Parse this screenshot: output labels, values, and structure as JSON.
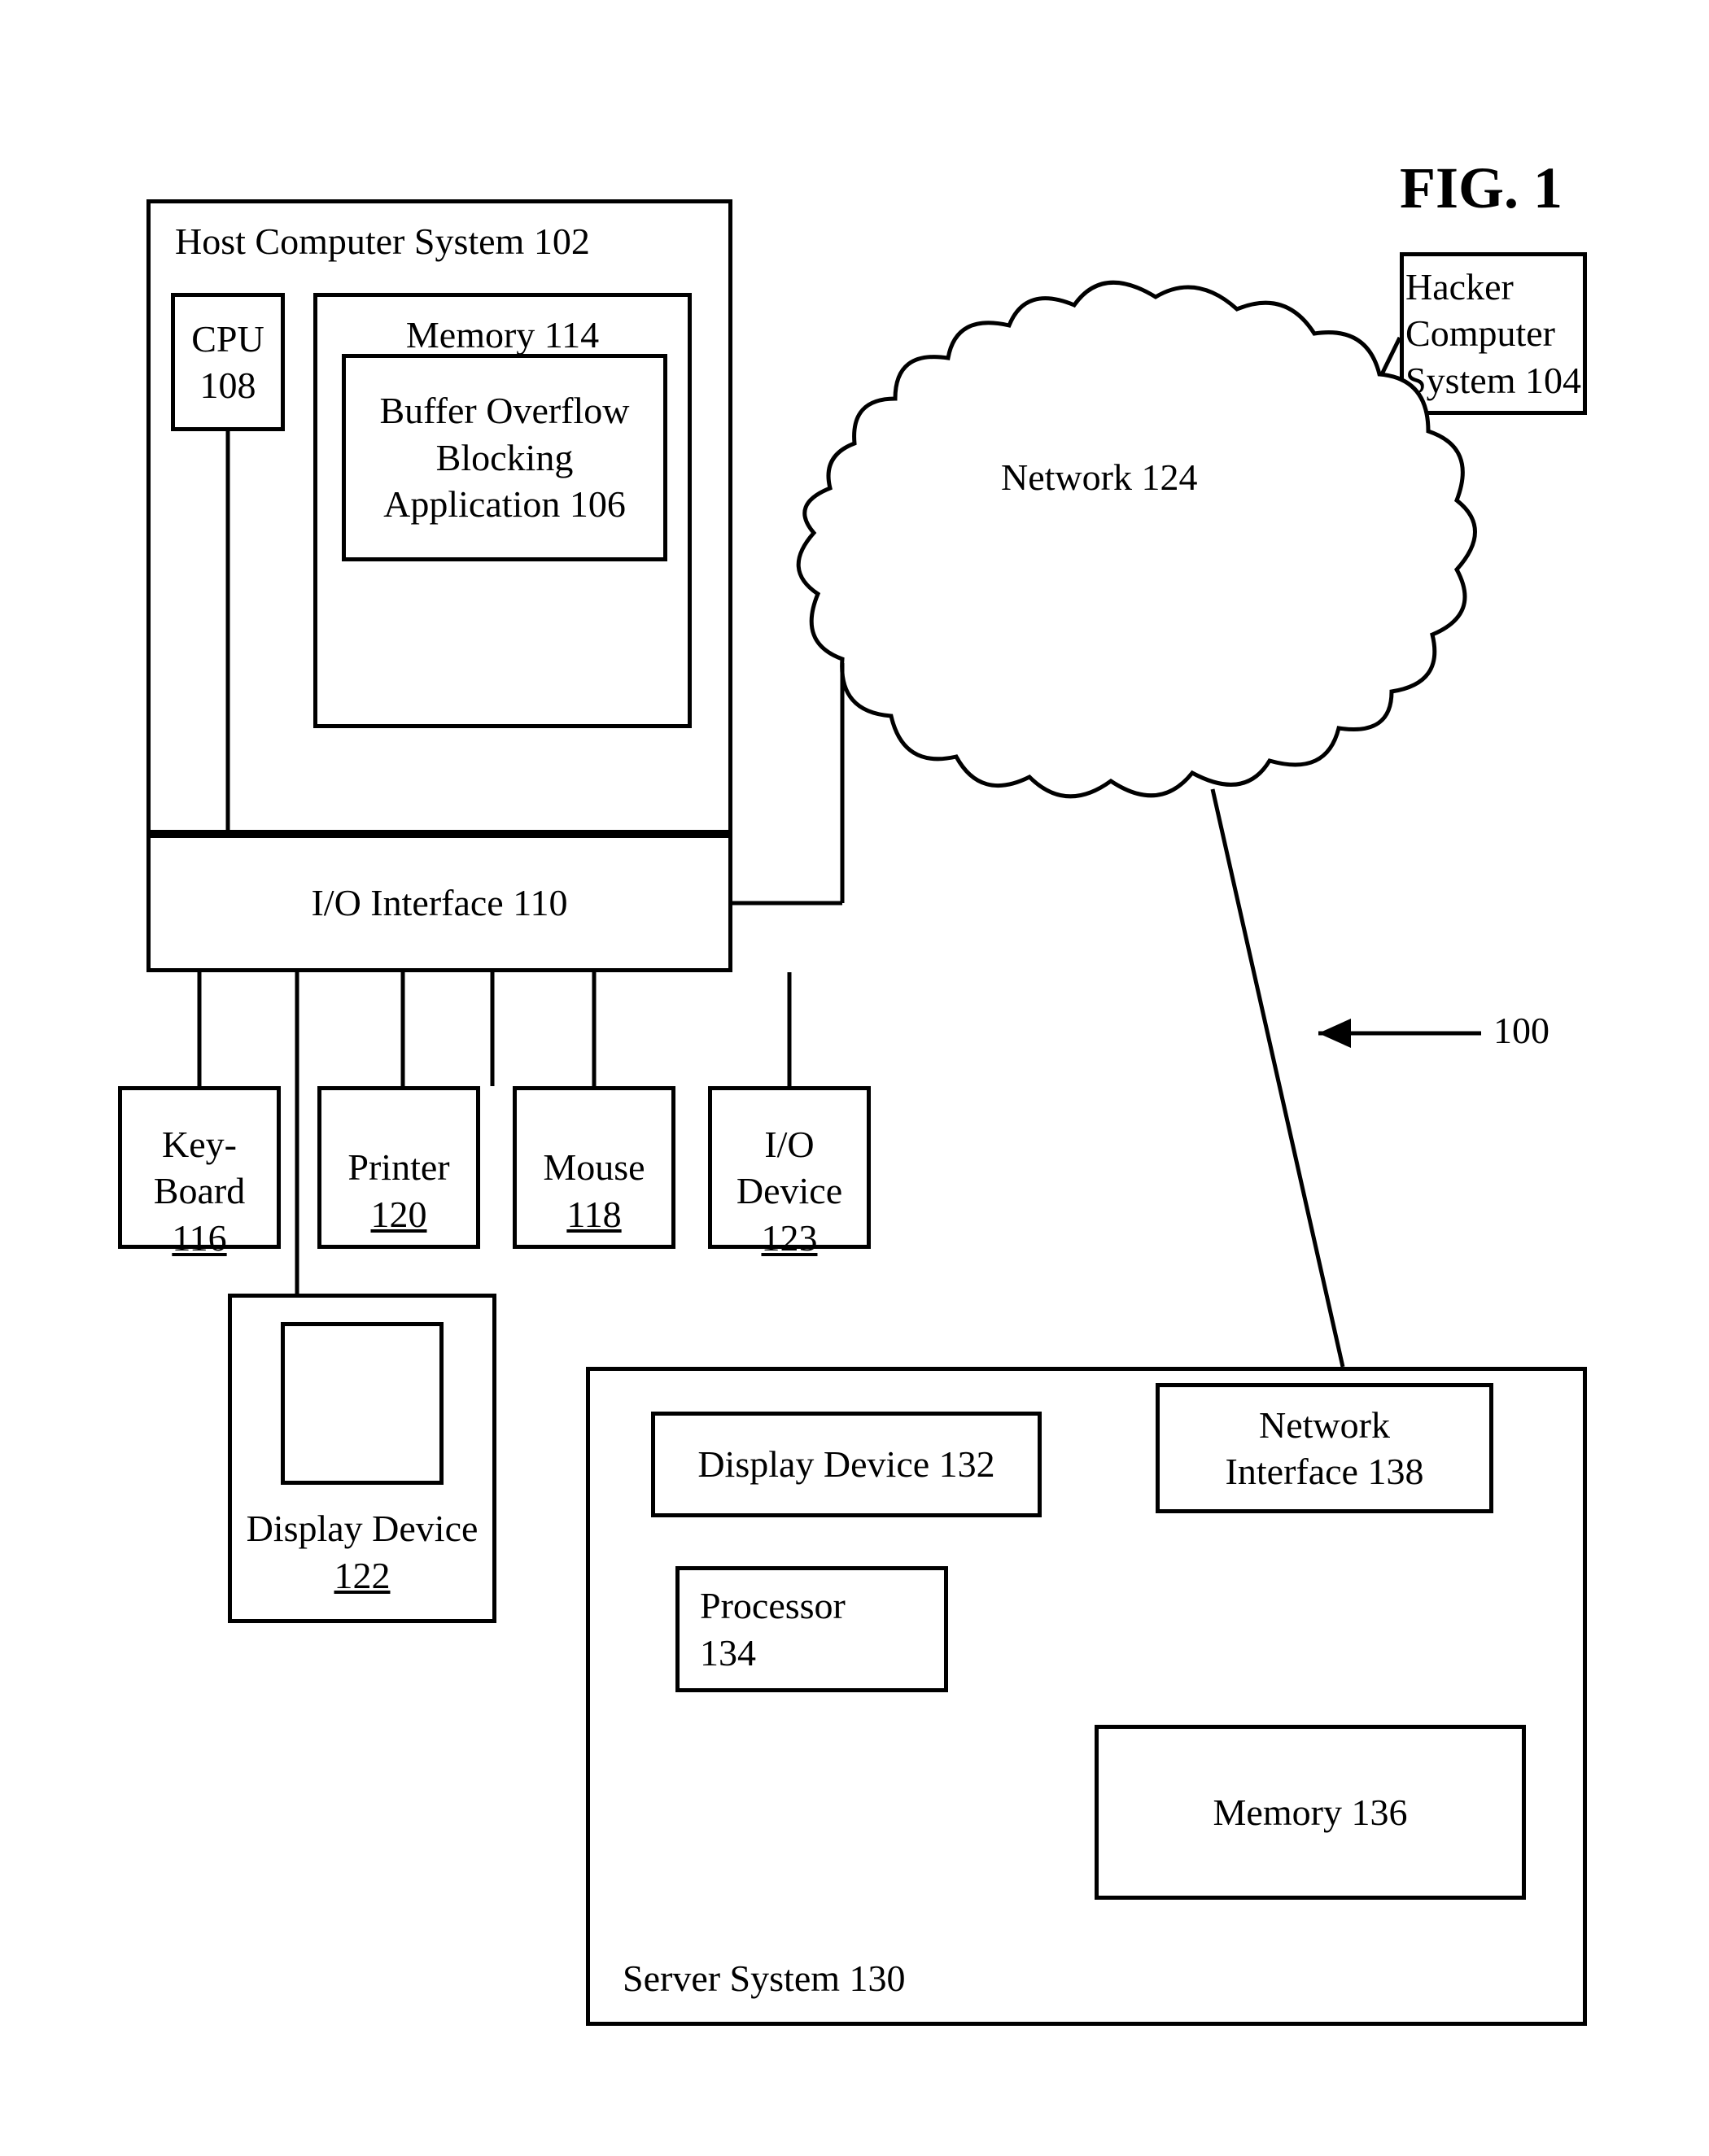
{
  "figure_title": "FIG. 1",
  "diagram_ref": "100",
  "host": {
    "title": "Host Computer System 102",
    "cpu": "CPU\n108",
    "memory": "Memory 114",
    "buffer_app": "Buffer Overflow\nBlocking\nApplication 106",
    "io_interface": "I/O Interface 110"
  },
  "peripherals": {
    "keyboard": "Key-\nBoard\n116",
    "printer": "Printer\n120",
    "mouse": "Mouse\n118",
    "io_device": "I/O\nDevice\n123",
    "display_device": "Display Device\n122"
  },
  "network": {
    "cloud": "Network 124",
    "hacker": "Hacker\nComputer\nSystem 104"
  },
  "server": {
    "title": "Server System 130",
    "display": "Display Device 132",
    "processor": "Processor\n134",
    "memory": "Memory 136",
    "net_interface": "Network\nInterface 138"
  }
}
